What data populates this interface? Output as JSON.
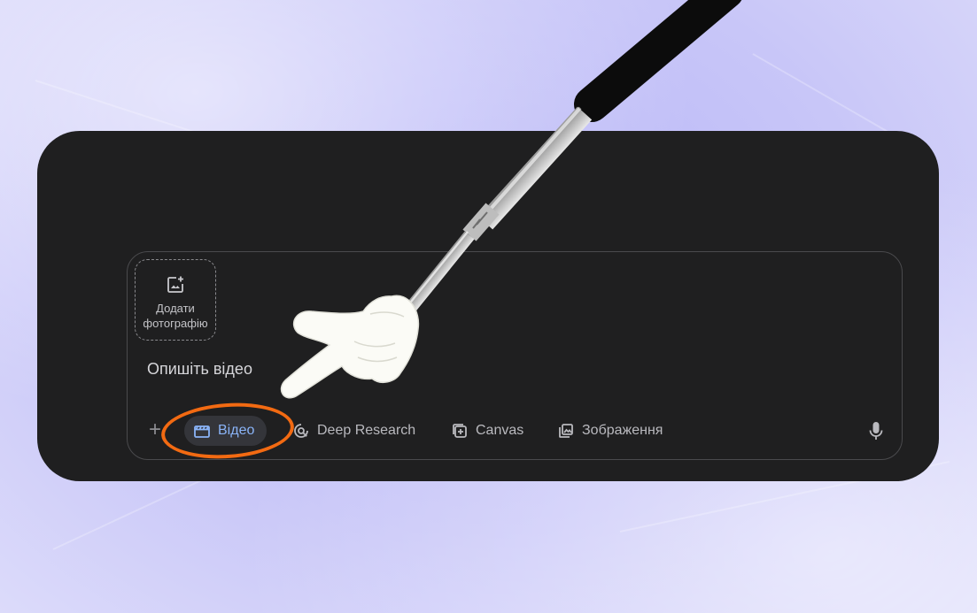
{
  "composer": {
    "upload_label_line1": "Додати",
    "upload_label_line2": "фотографію",
    "prompt_placeholder": "Опишіть відео"
  },
  "toolbar": {
    "plus_icon": "+",
    "tools": [
      {
        "label": "Відео",
        "icon": "clapperboard-icon",
        "active": true
      },
      {
        "label": "Deep Research",
        "icon": "deep-research-icon",
        "active": false
      },
      {
        "label": "Canvas",
        "icon": "canvas-icon",
        "active": false
      },
      {
        "label": "Зображення",
        "icon": "image-gallery-icon",
        "active": false
      }
    ],
    "mic_icon": "microphone-icon"
  },
  "colors": {
    "background": "#c4c2f8",
    "card": "#1f1f20",
    "active_chip_text": "#8ab4f8",
    "annotation_circle": "#f26a12"
  }
}
